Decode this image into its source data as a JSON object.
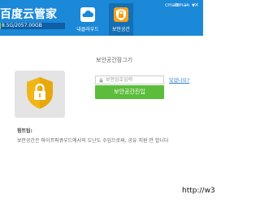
{
  "header": {
    "logo_text": "百度云管家",
    "storage_text": "8.5G/2057.00GB",
    "storage_fraction": 0.004,
    "tabs": [
      {
        "label": "내클라우드",
        "icon": "cloud-icon",
        "active": false
      },
      {
        "label": "보안공간",
        "icon": "security-space-icon",
        "active": true
      }
    ],
    "username": "cmairman",
    "window_buttons": [
      "menu-icon",
      "minimize-icon",
      "close-icon"
    ]
  },
  "security": {
    "title": "보안공간잠그기",
    "password_placeholder": "보안암호입력",
    "forgot_link": "잊었나요?",
    "enter_button": "보안공간진입",
    "tip_label": "힘트팁:",
    "tip_text": "보안공간은 파이프퍼큐우드에서의 도난도 수입으로써, 공유 지원 안 합니다"
  },
  "watermark": "http://w3",
  "colors": {
    "header_bg": "#1b88d8",
    "active_tab_bg": "#146fb5",
    "button_green": "#5bbd3b",
    "shield_gold": "#f2b516",
    "link_blue": "#2d7fd1"
  }
}
